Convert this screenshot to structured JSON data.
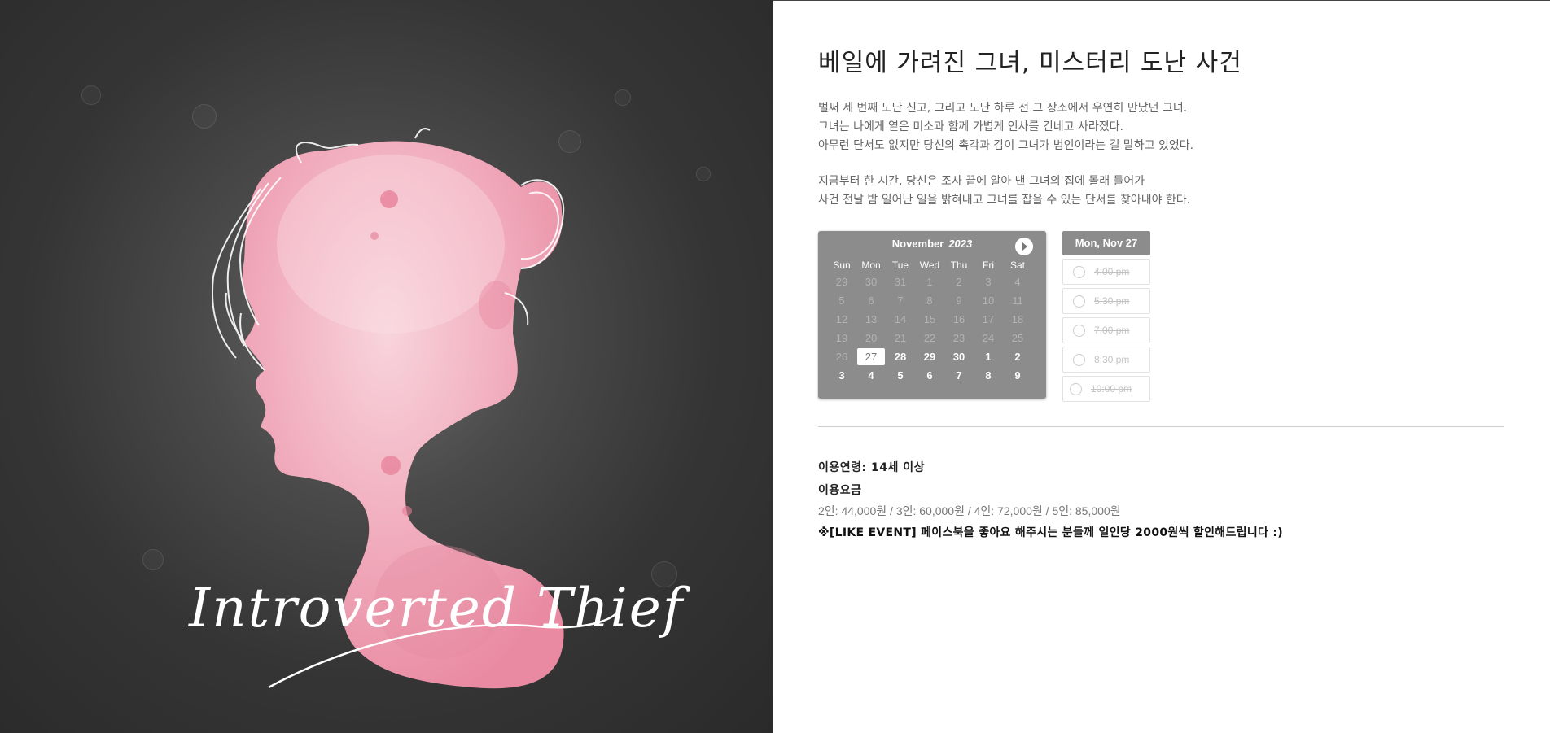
{
  "hero": {
    "logo_text": "Introverted Thief",
    "colors": {
      "background": "#333333",
      "silhouette": "#f2a9b8",
      "line": "#ffffff"
    }
  },
  "main": {
    "title": "베일에 가려진 그녀, 미스터리 도난 사건",
    "intro": [
      [
        "벌써 세 번째 도난 신고, 그리고 도난 하루 전 그 장소에서 우연히 만났던 그녀.",
        "그녀는 나에게 옅은 미소과 함께 가볍게 인사를 건네고 사라졌다.",
        "아무런 단서도 없지만 당신의 촉각과 감이 그녀가 범인이라는 걸 말하고 있었다."
      ],
      [
        "지금부터 한 시간, 당신은 조사 끝에 알아 낸 그녀의 집에 몰래 들어가",
        "사건 전날 밤 일어난 일을 밝혀내고 그녀를 잡을 수 있는 단서를 찾아내야 한다."
      ]
    ]
  },
  "calendar": {
    "month": "November",
    "year": "2023",
    "next_icon": "chevron-right-icon",
    "weekdays": [
      "Sun",
      "Mon",
      "Tue",
      "Wed",
      "Thu",
      "Fri",
      "Sat"
    ],
    "weeks": [
      [
        "29",
        "30",
        "31",
        "1",
        "2",
        "3",
        "4"
      ],
      [
        "5",
        "6",
        "7",
        "8",
        "9",
        "10",
        "11"
      ],
      [
        "12",
        "13",
        "14",
        "15",
        "16",
        "17",
        "18"
      ],
      [
        "19",
        "20",
        "21",
        "22",
        "23",
        "24",
        "25"
      ],
      [
        "26",
        "27",
        "28",
        "29",
        "30",
        "1",
        "2"
      ],
      [
        "3",
        "4",
        "5",
        "6",
        "7",
        "8",
        "9"
      ]
    ],
    "selected": "27",
    "available_from": "28"
  },
  "timeslots": {
    "selected_day": "Mon, Nov 27",
    "slots": [
      "4:00 pm",
      "5:30 pm",
      "7:00 pm",
      "8:30 pm",
      "10:00 pm"
    ]
  },
  "info": {
    "age": "이용연령: 14세 이상",
    "fee_title": "이용요금",
    "fees": "2인: 44,000원 / 3인: 60,000원 / 4인: 72,000원 / 5인: 85,000원",
    "event": "※[LIKE EVENT] 페이스북을 좋아요 해주시는 분들께 일인당 2000원씩 할인해드립니다 :)"
  }
}
